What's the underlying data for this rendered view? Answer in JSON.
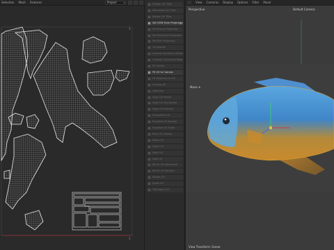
{
  "uv_editor": {
    "menu": [
      "Selection",
      "Mesh",
      "Features"
    ],
    "project_select": "Project"
  },
  "tool_panel": {
    "items": [
      {
        "label": "Flatten UV Tiles",
        "active": false
      },
      {
        "label": "Normalize UV Tiles",
        "active": false
      },
      {
        "label": "Rotate UV Tiles",
        "active": false
      },
      {
        "label": "Set UVW from Projection",
        "active": true,
        "dot": true
      },
      {
        "label": "Set Planar Projection",
        "active": false
      },
      {
        "label": "Set Spherical Projection",
        "active": false
      },
      {
        "label": "Set Box Projection",
        "active": false
      },
      {
        "label": "UV Islands",
        "active": false
      },
      {
        "label": "Unwrap Seamless Mapping",
        "active": false
      },
      {
        "label": "Unwrap Cylindrical Mapping",
        "active": false
      },
      {
        "label": "Pin Points",
        "active": false
      },
      {
        "label": "Fit UV to Canvas",
        "active": true
      },
      {
        "label": "Fit Selection to UV",
        "active": false
      },
      {
        "label": "Unwrap All",
        "active": false
      },
      {
        "label": "Optimize",
        "active": false
      },
      {
        "label": "Align UV Points",
        "active": false
      },
      {
        "label": "Align UV Horizontal",
        "active": false
      },
      {
        "label": "Align UV Vertical",
        "active": false
      },
      {
        "label": "Straighten UV",
        "active": false
      },
      {
        "label": "Equalize UV Islands",
        "active": false
      },
      {
        "label": "Equalize UV Scale",
        "active": false
      },
      {
        "label": "Pack UV Islands",
        "active": false
      },
      {
        "label": "Relax UV",
        "active": false
      },
      {
        "label": "Stitch UV",
        "active": false
      },
      {
        "label": "Weld UV",
        "active": false
      },
      {
        "label": "Split UV",
        "active": false
      },
      {
        "label": "Mirror UV Horizontal",
        "active": false
      },
      {
        "label": "Mirror UV Vertical",
        "active": false
      },
      {
        "label": "Rotate UV",
        "active": false
      },
      {
        "label": "Scale UV",
        "active": false
      },
      {
        "label": "Transform UV",
        "active": false
      }
    ]
  },
  "viewport": {
    "menu": [
      "View",
      "Cameras",
      "Display",
      "Options",
      "Filter",
      "Panel"
    ],
    "view_name": "Perspective",
    "camera_name": "Default Camera",
    "gizmo_label": "Move",
    "gizmo_symbol": "✛",
    "status_text": "View Transform: Scene"
  },
  "colors": {
    "accent_selected": "#c8c8c8",
    "uv_wire": "#e6e6e6",
    "fish_blue": "#3f86c8",
    "fish_orange": "#c98a2c",
    "axis_x": "#d23a3a",
    "axis_y": "#3ad26a",
    "axis_z": "#3a66d2"
  }
}
